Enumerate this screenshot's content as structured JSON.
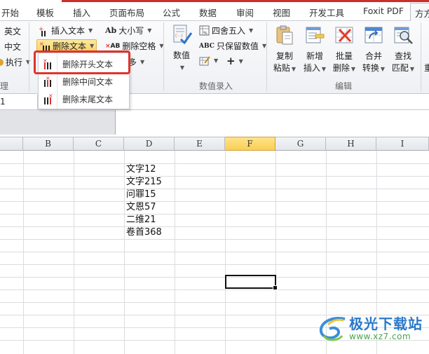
{
  "tabs": [
    {
      "label": "开始"
    },
    {
      "label": "模板"
    },
    {
      "label": "插入"
    },
    {
      "label": "页面布局"
    },
    {
      "label": "公式"
    },
    {
      "label": "数据"
    },
    {
      "label": "审阅"
    },
    {
      "label": "视图"
    },
    {
      "label": "开发工具"
    },
    {
      "label": "Foxit PDF"
    },
    {
      "label": "方方",
      "active": true
    }
  ],
  "ribbon": {
    "left_group": {
      "items": [
        "英文",
        "中文",
        "执行"
      ],
      "label": "理"
    },
    "text_group": {
      "insert_text": "插入文本",
      "delete_text": "删除文本",
      "case": "大小写",
      "delete_spaces": "删除空格",
      "more": "多"
    },
    "number_group": {
      "number_button": "数值",
      "round": "四舍五入",
      "keep_values": "只保留数值",
      "plus": "+",
      "label": "数值录入"
    },
    "edit_group": {
      "buttons": [
        {
          "line1": "复制",
          "line2": "粘贴"
        },
        {
          "line1": "新增",
          "line2": "插入"
        },
        {
          "line1": "批量",
          "line2": "删除"
        },
        {
          "line1": "合并",
          "line2": "转换"
        },
        {
          "line1": "查找",
          "line2": "匹配"
        }
      ],
      "label": "编辑"
    },
    "partial_right": "重"
  },
  "dropdown_menu": {
    "items": [
      {
        "label": "删除开头文本",
        "highlighted": true
      },
      {
        "label": "删除中间文本"
      },
      {
        "label": "删除末尾文本"
      }
    ]
  },
  "formula_bar": {
    "name_box": "1"
  },
  "sheet": {
    "columns": [
      "B",
      "C",
      "D",
      "E",
      "F",
      "G",
      "H",
      "I"
    ],
    "selected_column": "F",
    "cells_D": [
      "文字12",
      "文字215",
      "问罪15",
      "文恩57",
      "二维21",
      "卷首368"
    ]
  },
  "watermark": {
    "brand": "极光下载站",
    "url": "www.xz7.com"
  },
  "colors": {
    "accent_red": "#e0332b",
    "selected_header": "#f9cf55"
  }
}
